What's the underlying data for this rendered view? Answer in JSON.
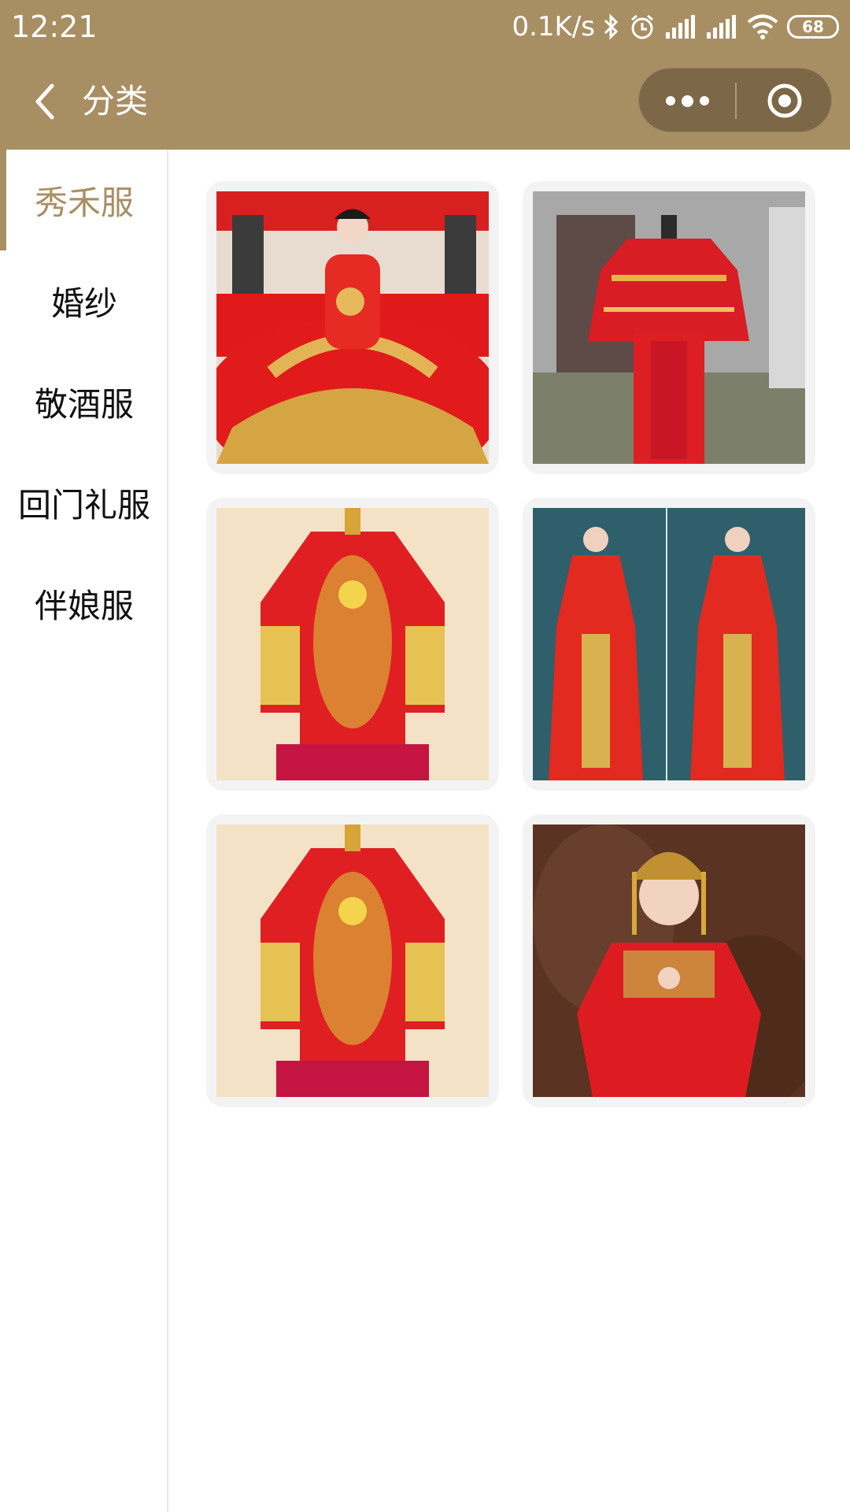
{
  "status_bar": {
    "time": "12:21",
    "network_speed": "0.1K/s",
    "battery": "68",
    "icons": [
      "bluetooth-icon",
      "alarm-icon",
      "signal-icon",
      "signal-icon",
      "wifi-icon",
      "battery-icon"
    ]
  },
  "nav": {
    "title": "分类",
    "back_icon": "chevron-left-icon",
    "more_icon": "more-dots-icon",
    "close_icon": "target-circle-icon"
  },
  "colors": {
    "accent": "#a88f63",
    "background": "#ffffff",
    "card_background": "#f3f3f3"
  },
  "sidebar": {
    "items": [
      {
        "label": "秀禾服",
        "active": true
      },
      {
        "label": "婚纱",
        "active": false
      },
      {
        "label": "敬酒服",
        "active": false
      },
      {
        "label": "回门礼服",
        "active": false
      },
      {
        "label": "伴娘服",
        "active": false
      }
    ]
  },
  "products": [
    {
      "image": "red-xiuhe-dress-on-bed-photo"
    },
    {
      "image": "red-xiuhe-dress-on-mannequin-photo"
    },
    {
      "image": "red-gold-xiuhe-jacket-photo"
    },
    {
      "image": "two-brides-in-xiuhe-dress-photo"
    },
    {
      "image": "red-gold-xiuhe-jacket-photo"
    },
    {
      "image": "bride-with-headdress-in-xiuhe-photo"
    }
  ]
}
